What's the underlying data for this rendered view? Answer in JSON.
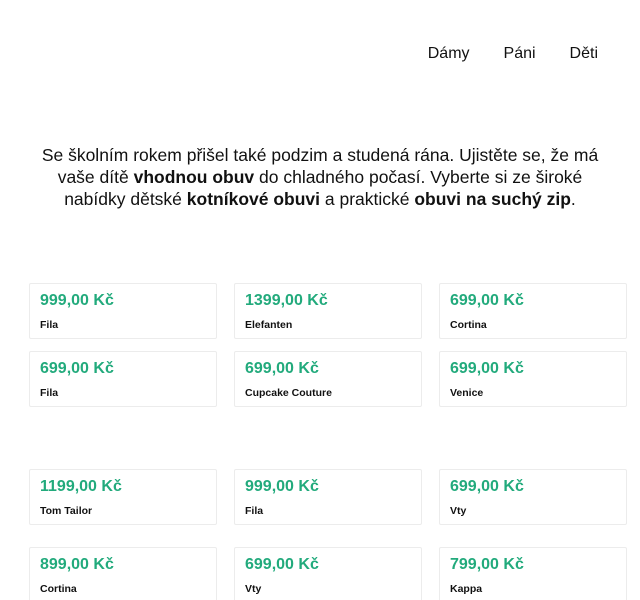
{
  "nav": {
    "items": [
      {
        "label": "Dámy"
      },
      {
        "label": "Páni"
      },
      {
        "label": "Děti"
      }
    ]
  },
  "intro": {
    "part1": "Se školním rokem přišel také podzim a studená rána. Ujistěte se, že má vaše dítě ",
    "bold1": "vhodnou obuv",
    "part2": " do chladného počasí. Vyberte si ze široké nabídky dětské ",
    "bold2": "kotníkové obuvi",
    "part3": " a praktické ",
    "bold3": "obuvi na suchý zip",
    "part4": "."
  },
  "colors": {
    "price": "#22aa7c",
    "card_border": "#ececec"
  },
  "products": [
    {
      "price": "999,00 Kč",
      "brand": "Fila"
    },
    {
      "price": "1399,00 Kč",
      "brand": "Elefanten"
    },
    {
      "price": "699,00 Kč",
      "brand": "Cortina"
    },
    {
      "price": "699,00 Kč",
      "brand": "Fila"
    },
    {
      "price": "699,00 Kč",
      "brand": "Cupcake Couture"
    },
    {
      "price": "699,00 Kč",
      "brand": "Venice"
    },
    {
      "price": "1199,00 Kč",
      "brand": "Tom Tailor"
    },
    {
      "price": "999,00 Kč",
      "brand": "Fila"
    },
    {
      "price": "699,00 Kč",
      "brand": "Vty"
    },
    {
      "price": "899,00 Kč",
      "brand": "Cortina"
    },
    {
      "price": "699,00 Kč",
      "brand": "Vty"
    },
    {
      "price": "799,00 Kč",
      "brand": "Kappa"
    }
  ]
}
